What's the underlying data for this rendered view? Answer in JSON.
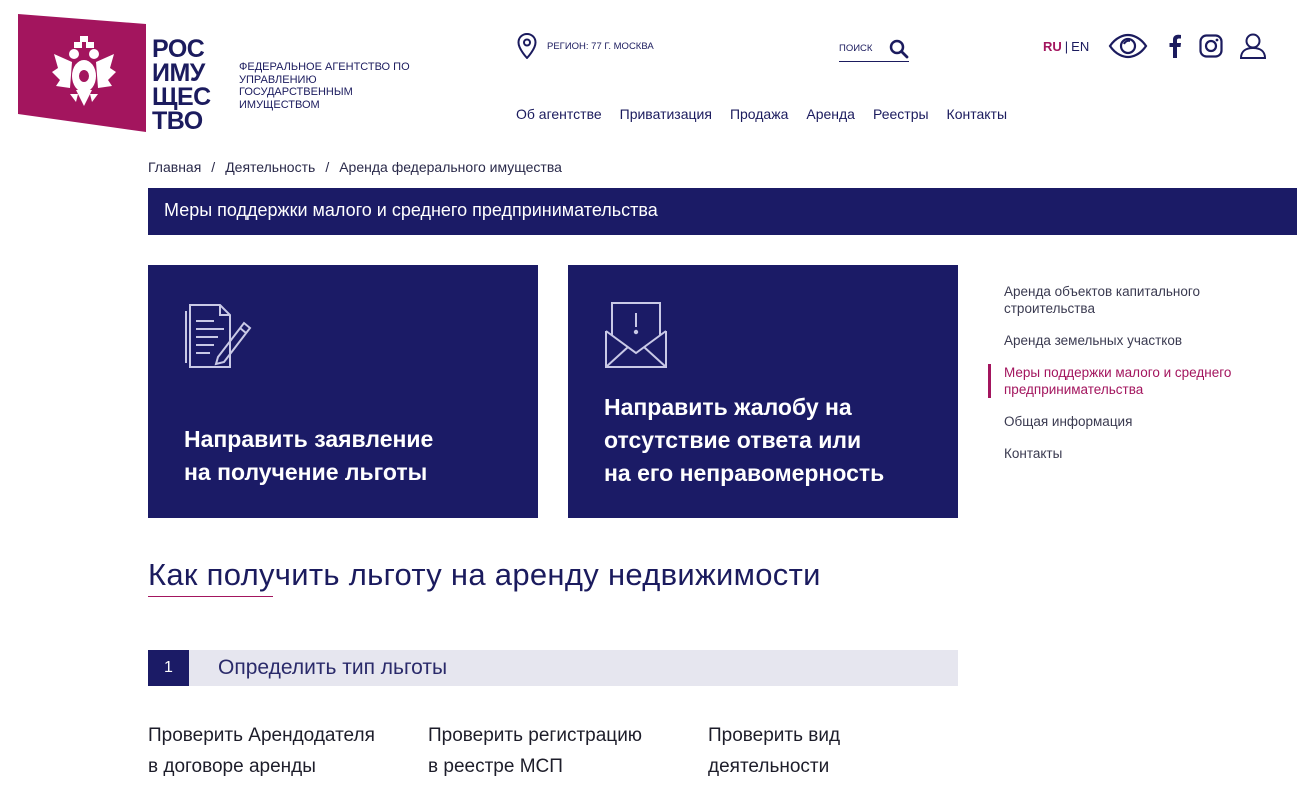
{
  "colors": {
    "brand_navy": "#1b1b66",
    "accent_magenta": "#a3155e"
  },
  "logo": {
    "word_lines": [
      "РОС",
      "ИМУ",
      "ЩЕС",
      "ТВО"
    ],
    "agency_name": "ФЕДЕРАЛЬНОЕ АГЕНТСТВО ПО УПРАВЛЕНИЮ ГОСУДАРСТВЕННЫМ ИМУЩЕСТВОМ"
  },
  "header": {
    "region": "РЕГИОН: 77 Г. МОСКВА",
    "search_placeholder": "ПОИСК",
    "lang_active": "RU",
    "lang_separator": "|",
    "lang_other": "EN",
    "icons": [
      "location-pin-icon",
      "search-icon",
      "eye-accessibility-icon",
      "facebook-icon",
      "instagram-icon",
      "user-icon"
    ]
  },
  "main_nav": [
    "Об агентстве",
    "Приватизация",
    "Продажа",
    "Аренда",
    "Реестры",
    "Контакты"
  ],
  "breadcrumb": [
    "Главная",
    "Деятельность",
    "Аренда федерального имущества"
  ],
  "page_title": "Меры поддержки малого и среднего предпринимательства",
  "cards": [
    {
      "lines": [
        "Направить заявление",
        "на получение льготы"
      ],
      "icon": "document-pen-icon"
    },
    {
      "lines": [
        "Направить жалобу на",
        "отсутствие ответа или",
        "на его неправомерность"
      ],
      "icon": "envelope-alert-icon"
    }
  ],
  "side_nav": [
    {
      "label": "Аренда объектов капитального строительства",
      "active": false
    },
    {
      "label": "Аренда земельных участков",
      "active": false
    },
    {
      "label": "Меры поддержки малого и среднего предпринимательства",
      "active": true
    },
    {
      "label": "Общая информация",
      "active": false
    },
    {
      "label": "Контакты",
      "active": false
    }
  ],
  "section_title": "Как получить льготу на аренду недвижимости",
  "step": {
    "number": "1",
    "label": "Определить тип льготы"
  },
  "checks": [
    [
      "Проверить Арендодателя",
      "в договоре аренды"
    ],
    [
      "Проверить регистрацию",
      "в реестре МСП"
    ],
    [
      "Проверить вид",
      "деятельности"
    ]
  ]
}
